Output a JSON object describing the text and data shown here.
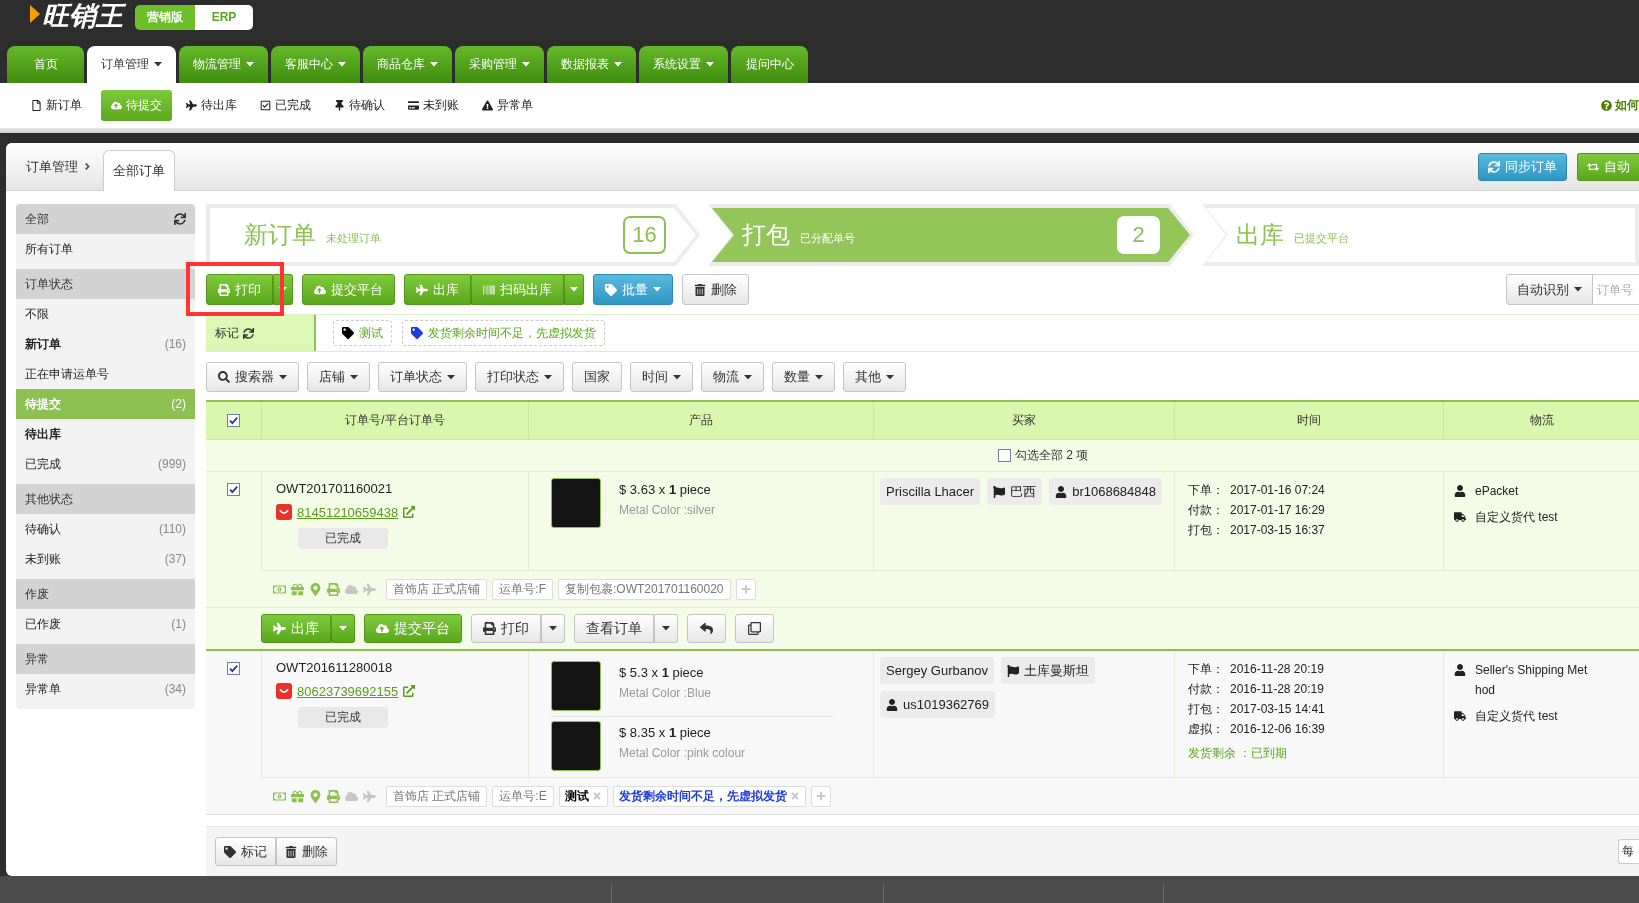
{
  "logo": {
    "text": "旺销王",
    "edition": "营销版",
    "product": "ERP"
  },
  "nav": [
    {
      "label": "首页",
      "caret": false,
      "selected": false
    },
    {
      "label": "订单管理",
      "caret": true,
      "selected": true
    },
    {
      "label": "物流管理",
      "caret": true,
      "selected": false
    },
    {
      "label": "客服中心",
      "caret": true,
      "selected": false
    },
    {
      "label": "商品仓库",
      "caret": true,
      "selected": false
    },
    {
      "label": "采购管理",
      "caret": true,
      "selected": false
    },
    {
      "label": "数据报表",
      "caret": true,
      "selected": false
    },
    {
      "label": "系统设置",
      "caret": true,
      "selected": false
    },
    {
      "label": "提问中心",
      "caret": false,
      "selected": false
    }
  ],
  "subnav": {
    "items": [
      {
        "label": "新订单",
        "selected": false
      },
      {
        "label": "待提交",
        "selected": true
      },
      {
        "label": "待出库",
        "selected": false
      },
      {
        "label": "已完成",
        "selected": false
      },
      {
        "label": "待确认",
        "selected": false
      },
      {
        "label": "未到账",
        "selected": false
      },
      {
        "label": "异常单",
        "selected": false
      }
    ],
    "help": "如何"
  },
  "breadcrumb": {
    "root": "订单管理",
    "tab": "全部订单",
    "buttons": [
      {
        "label": "同步订单"
      },
      {
        "label": "自动"
      }
    ]
  },
  "sidebar": [
    {
      "title": "全部",
      "refresh": true,
      "items": [
        {
          "label": "所有订单",
          "emphasized": false,
          "selected": false
        }
      ]
    },
    {
      "title": "订单状态",
      "refresh": false,
      "items": [
        {
          "label": "不限",
          "emphasized": false,
          "selected": false
        },
        {
          "label": "新订单",
          "count": "(16)",
          "emphasized": true,
          "selected": false
        },
        {
          "label": "正在申请运单号",
          "emphasized": false,
          "selected": false
        },
        {
          "label": "待提交",
          "count": "(2)",
          "emphasized": true,
          "selected": true
        },
        {
          "label": "待出库",
          "emphasized": true,
          "selected": false
        },
        {
          "label": "已完成",
          "count": "(999)",
          "emphasized": false,
          "selected": false
        }
      ]
    },
    {
      "title": "其他状态",
      "refresh": false,
      "items": [
        {
          "label": "待确认",
          "count": "(110)",
          "emphasized": false,
          "selected": false
        },
        {
          "label": "未到账",
          "count": "(37)",
          "emphasized": false,
          "selected": false
        }
      ]
    },
    {
      "title": "作废",
      "refresh": false,
      "items": [
        {
          "label": "已作废",
          "count": "(1)",
          "emphasized": false,
          "selected": false
        }
      ]
    },
    {
      "title": "异常",
      "refresh": false,
      "items": [
        {
          "label": "异常单",
          "count": "(34)",
          "emphasized": false,
          "selected": false
        }
      ]
    }
  ],
  "steps": [
    {
      "title": "新订单",
      "subtitle": "未处理订单",
      "count": "16",
      "selected": false
    },
    {
      "title": "打包",
      "subtitle": "已分配单号",
      "count": "2",
      "selected": true
    },
    {
      "title": "出库",
      "subtitle": "已提交平台",
      "selected": false
    }
  ],
  "toolbar": {
    "groups": [
      {
        "dropdown": true,
        "highlighted": true,
        "buttons": [
          {
            "label": "打印",
            "caret": false
          }
        ]
      },
      {
        "dropdown": false,
        "highlighted": false,
        "buttons": [
          {
            "label": "提交平台",
            "caret": false
          }
        ]
      },
      {
        "dropdown": true,
        "highlighted": false,
        "buttons": [
          {
            "label": "出库",
            "caret": false
          },
          {
            "label": "扫码出库",
            "caret": false
          }
        ]
      },
      {
        "dropdown": false,
        "highlighted": false,
        "buttons": [
          {
            "label": "批量",
            "caret": true
          }
        ]
      },
      {
        "dropdown": false,
        "highlighted": false,
        "buttons": [
          {
            "label": "删除",
            "caret": false
          }
        ]
      }
    ],
    "search": {
      "mode": "自动识别",
      "placeholder": "订单号"
    }
  },
  "mark_bar": {
    "label": "标记",
    "tags": [
      {
        "label": "测试",
        "color": "#000000"
      },
      {
        "label": "发货剩余时间不足，先虚拟发货",
        "color": "#1f3bd8"
      }
    ]
  },
  "filters": [
    {
      "label": "搜索器",
      "caret": true
    },
    {
      "label": "店铺",
      "caret": true
    },
    {
      "label": "订单状态",
      "caret": true
    },
    {
      "label": "打印状态",
      "caret": true
    },
    {
      "label": "国家",
      "caret": false
    },
    {
      "label": "时间",
      "caret": true
    },
    {
      "label": "物流",
      "caret": true
    },
    {
      "label": "数量",
      "caret": true
    },
    {
      "label": "其他",
      "caret": true
    }
  ],
  "table": {
    "header_checked": true,
    "columns": [
      "订单号/平台订单号",
      "产品",
      "买家",
      "时间",
      "物流"
    ],
    "select_all": {
      "label": "勾选全部 2 项",
      "checked": false
    }
  },
  "orders": [
    {
      "checked": true,
      "active": true,
      "order_no": "OWT201701160021",
      "platform_no": "81451210659438",
      "status": "已完成",
      "products": [
        {
          "line": "$ 3.63 x **1** piece",
          "spec": "Metal Color :silver"
        }
      ],
      "buyer": {
        "name": "Priscilla Lhacer",
        "country": "巴西",
        "account": "br1068684848"
      },
      "times": [
        {
          "label": "下单：",
          "value": "2017-01-16 07:24"
        },
        {
          "label": "付款：",
          "value": "2017-01-17 16:29"
        },
        {
          "label": "打包：",
          "value": "2017-03-15 16:37"
        }
      ],
      "logistics": [
        "ePacket",
        "自定义货代 test"
      ],
      "flags": [
        {
          "on": true
        },
        {
          "on": true
        },
        {
          "on": true
        },
        {
          "on": true
        },
        {
          "on": false
        },
        {
          "on": false
        }
      ],
      "chips": [
        "首饰店 正式店铺",
        "运单号:F",
        "复制包裹:OWT201701160020"
      ],
      "actions": [
        {
          "label": "出库",
          "caret": true
        },
        {
          "label": "提交平台",
          "caret": false
        },
        {
          "label": "打印",
          "caret": true
        },
        {
          "label": "查看订单",
          "caret": true
        },
        {
          "caret": false
        },
        {
          "caret": false
        }
      ]
    },
    {
      "checked": true,
      "active": false,
      "order_no": "OWT201611280018",
      "platform_no": "80623739692155",
      "status": "已完成",
      "products": [
        {
          "line": "$ 5.3 x **1** piece",
          "spec": "Metal Color :Blue"
        },
        {
          "line": "$ 8.35 x **1** piece",
          "spec": "Metal Color :pink colour"
        }
      ],
      "buyer": {
        "name": "Sergey Gurbanov",
        "country": "土库曼斯坦",
        "account": "us1019362769"
      },
      "times": [
        {
          "label": "下单：",
          "value": "2016-11-28 20:19"
        },
        {
          "label": "付款：",
          "value": "2016-11-28 20:19"
        },
        {
          "label": "打包：",
          "value": "2017-03-15 14:41"
        },
        {
          "label": "虚拟：",
          "value": "2016-12-06 16:39"
        }
      ],
      "note": "发货剩余 ：已到期",
      "logistics": [
        "Seller's Shipping Method",
        "自定义货代 test"
      ],
      "flags": [
        {
          "on": true
        },
        {
          "on": true
        },
        {
          "on": true
        },
        {
          "on": true
        },
        {
          "on": false
        },
        {
          "on": false
        }
      ],
      "chips": [
        "首饰店 正式店铺",
        "运单号:E"
      ],
      "tags": [
        {
          "label": "测试",
          "color": "#000000"
        },
        {
          "label": "发货剩余时间不足，先虚拟发货",
          "color": "#1f3bd8"
        }
      ]
    }
  ],
  "bottom": {
    "actions": [
      {
        "label": "标记"
      },
      {
        "label": "删除"
      }
    ],
    "page_size": "每"
  }
}
